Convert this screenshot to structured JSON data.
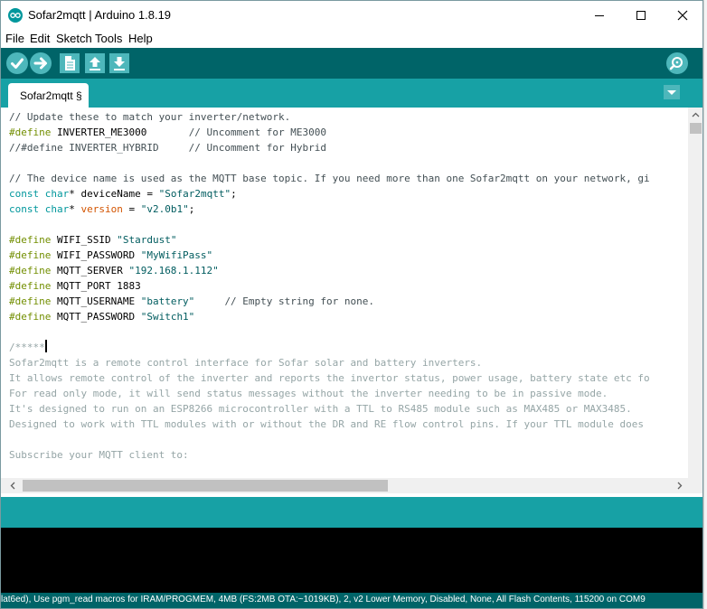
{
  "window": {
    "title": "Sofar2mqtt | Arduino 1.8.19",
    "controls": [
      "minimize",
      "maximize",
      "close"
    ]
  },
  "menu": [
    "File",
    "Edit",
    "Sketch",
    "Tools",
    "Help"
  ],
  "toolbar": {
    "buttons": [
      "verify-icon",
      "upload-icon",
      "new-icon",
      "open-icon",
      "save-icon",
      "serial-monitor-icon"
    ]
  },
  "tabs": [
    {
      "label": "Sofar2mqtt §",
      "active": true
    }
  ],
  "editor": {
    "lines": [
      [
        {
          "c": "cm",
          "t": "// Update these to match your inverter/network."
        }
      ],
      [
        {
          "c": "kw",
          "t": "#define"
        },
        {
          "c": "",
          "t": " INVERTER_ME3000       "
        },
        {
          "c": "cm",
          "t": "// Uncomment for ME3000"
        }
      ],
      [
        {
          "c": "cm",
          "t": "//#define INVERTER_HYBRID     // Uncomment for Hybrid"
        }
      ],
      [],
      [
        {
          "c": "cm",
          "t": "// The device name is used as the MQTT base topic. If you need more than one Sofar2mqtt on your network, gi"
        }
      ],
      [
        {
          "c": "ty",
          "t": "const"
        },
        {
          "c": "",
          "t": " "
        },
        {
          "c": "ty",
          "t": "char"
        },
        {
          "c": "",
          "t": "* deviceName = "
        },
        {
          "c": "st",
          "t": "\"Sofar2mqtt\""
        },
        {
          "c": "",
          "t": ";"
        }
      ],
      [
        {
          "c": "ty",
          "t": "const"
        },
        {
          "c": "",
          "t": " "
        },
        {
          "c": "ty",
          "t": "char"
        },
        {
          "c": "",
          "t": "* "
        },
        {
          "c": "fn",
          "t": "version"
        },
        {
          "c": "",
          "t": " = "
        },
        {
          "c": "st",
          "t": "\"v2.0b1\""
        },
        {
          "c": "",
          "t": ";"
        }
      ],
      [],
      [
        {
          "c": "kw",
          "t": "#define"
        },
        {
          "c": "",
          "t": " WIFI_SSID "
        },
        {
          "c": "st",
          "t": "\"Stardust\""
        }
      ],
      [
        {
          "c": "kw",
          "t": "#define"
        },
        {
          "c": "",
          "t": " WIFI_PASSWORD "
        },
        {
          "c": "st",
          "t": "\"MyWifiPass\""
        }
      ],
      [
        {
          "c": "kw",
          "t": "#define"
        },
        {
          "c": "",
          "t": " MQTT_SERVER "
        },
        {
          "c": "st",
          "t": "\"192.168.1.112\""
        }
      ],
      [
        {
          "c": "kw",
          "t": "#define"
        },
        {
          "c": "",
          "t": " MQTT_PORT 1883"
        }
      ],
      [
        {
          "c": "kw",
          "t": "#define"
        },
        {
          "c": "",
          "t": " MQTT_USERNAME "
        },
        {
          "c": "st",
          "t": "\"battery\""
        },
        {
          "c": "",
          "t": "     "
        },
        {
          "c": "cm",
          "t": "// Empty string for none."
        }
      ],
      [
        {
          "c": "kw",
          "t": "#define"
        },
        {
          "c": "",
          "t": " MQTT_PASSWORD "
        },
        {
          "c": "st",
          "t": "\"Switch1\""
        }
      ],
      [],
      [
        {
          "c": "cmd",
          "t": "/*****"
        },
        {
          "c": "caret",
          "t": ""
        }
      ],
      [
        {
          "c": "cmd",
          "t": "Sofar2mqtt is a remote control interface for Sofar solar and battery inverters."
        }
      ],
      [
        {
          "c": "cmd",
          "t": "It allows remote control of the inverter and reports the invertor status, power usage, battery state etc fo"
        }
      ],
      [
        {
          "c": "cmd",
          "t": "For read only mode, it will send status messages without the inverter needing to be in passive mode."
        }
      ],
      [
        {
          "c": "cmd",
          "t": "It's designed to run on an ESP8266 microcontroller with a TTL to RS485 module such as MAX485 or MAX3485."
        }
      ],
      [
        {
          "c": "cmd",
          "t": "Designed to work with TTL modules with or without the DR and RE flow control pins. If your TTL module does "
        }
      ],
      [],
      [
        {
          "c": "cmd",
          "t": "Subscribe your MQTT client to:"
        }
      ]
    ]
  },
  "status_bar": {
    "text": "lat6ed), Use pgm_read macros for IRAM/PROGMEM, 4MB (FS:2MB OTA:~1019KB), 2, v2 Lower Memory, Disabled, None, All Flash Contents, 115200 on COM9"
  },
  "colors": {
    "toolbar": "#006468",
    "tabbar": "#17a1a5",
    "button": "#4db7bb",
    "console": "#000000"
  }
}
